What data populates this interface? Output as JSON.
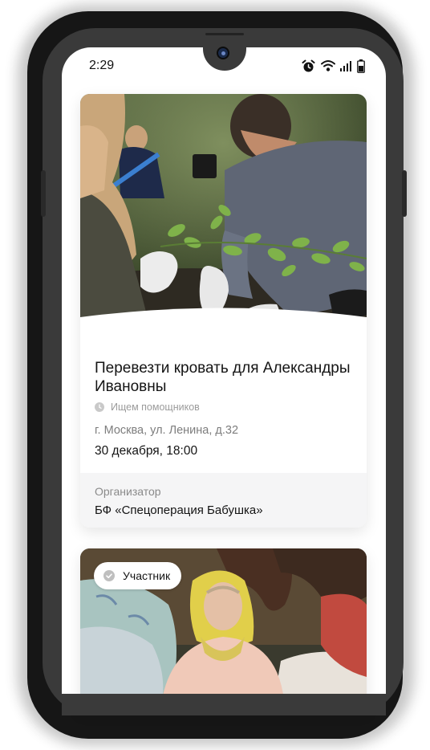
{
  "status_bar": {
    "time": "2:29",
    "icons": [
      "alarm-icon",
      "wifi-icon",
      "signal-icon",
      "battery-icon"
    ]
  },
  "cards": [
    {
      "image": "volunteers-planting-photo",
      "title": "Перевезти кровать для Александры Ивановны",
      "status": "Ищем помощников",
      "status_icon": "clock-icon",
      "address": "г. Москва, ул. Ленина, д.32",
      "datetime": "30 декабря, 18:00",
      "organizer_label": "Организатор",
      "organizer_name": "БФ «Спецоперация Бабушка»"
    },
    {
      "image": "elderly-woman-photo",
      "badge": "Участник",
      "badge_icon": "check-circle-icon"
    }
  ],
  "colors": {
    "text_primary": "#141414",
    "text_secondary": "#9b9b9b",
    "organizer_bg": "#f5f5f6",
    "phone_frame": "#3a3a3a"
  }
}
